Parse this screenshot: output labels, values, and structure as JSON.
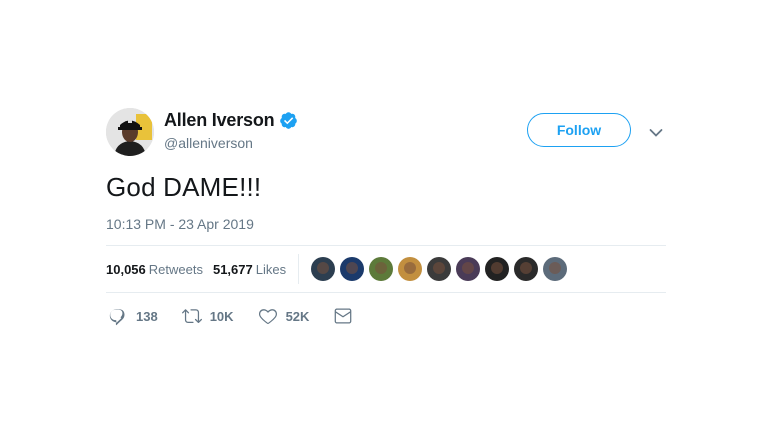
{
  "user": {
    "name": "Allen Iverson",
    "handle": "@alleniverson"
  },
  "follow_label": "Follow",
  "tweet": {
    "text": "God DAME!!!",
    "timestamp": "10:13 PM - 23 Apr 2019"
  },
  "stats": {
    "retweets_count": "10,056",
    "retweets_label": "Retweets",
    "likes_count": "51,677",
    "likes_label": "Likes"
  },
  "likers": [
    {
      "color": "#2c3e50"
    },
    {
      "color": "#1b3a6b"
    },
    {
      "color": "#5d7a3a"
    },
    {
      "color": "#c28f3f"
    },
    {
      "color": "#3b3b3b"
    },
    {
      "color": "#4a3b57"
    },
    {
      "color": "#222222"
    },
    {
      "color": "#2a2a2a"
    },
    {
      "color": "#5c6b7a"
    }
  ],
  "actions": {
    "replies": "138",
    "retweets": "10K",
    "likes": "52K"
  },
  "colors": {
    "accent": "#1da1f2",
    "secondary_text": "#657786",
    "border": "#e6ecf0"
  },
  "icons": [
    "verified-badge-icon",
    "chevron-down-icon",
    "reply-icon",
    "retweet-icon",
    "like-icon",
    "direct-message-icon"
  ]
}
